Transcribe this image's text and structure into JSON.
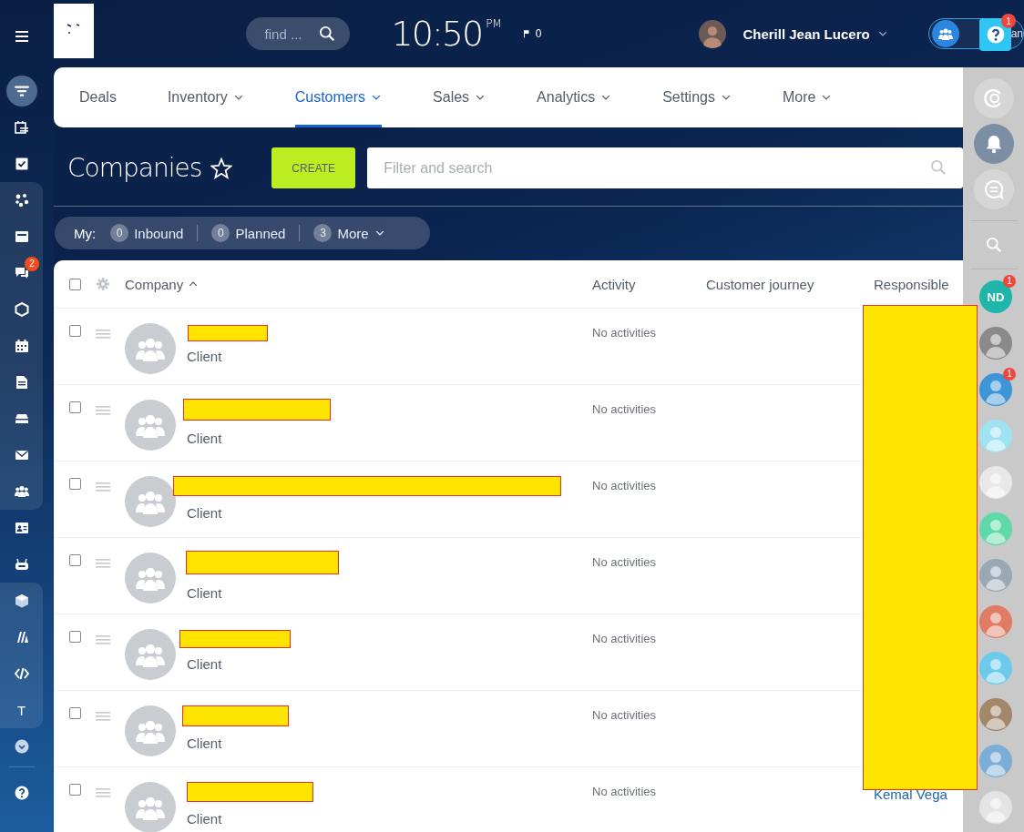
{
  "sidebar": {
    "chat_badge": "2",
    "text_tool": "T"
  },
  "header": {
    "search": {
      "placeholder": "find ..."
    },
    "time": "10:50",
    "meridiem": "PM",
    "flags": "0",
    "user": {
      "name": "Cherill Jean Lucero"
    },
    "workspace": {
      "label": "an"
    },
    "help": {
      "badge": "1"
    }
  },
  "tabs": [
    {
      "label": "Deals",
      "selected": false,
      "dropdown": false
    },
    {
      "label": "Inventory",
      "selected": false,
      "dropdown": true
    },
    {
      "label": "Customers",
      "selected": true,
      "dropdown": true
    },
    {
      "label": "Sales",
      "selected": false,
      "dropdown": true
    },
    {
      "label": "Analytics",
      "selected": false,
      "dropdown": true
    },
    {
      "label": "Settings",
      "selected": false,
      "dropdown": true
    },
    {
      "label": "More",
      "selected": false,
      "dropdown": true
    }
  ],
  "page": {
    "title": "Companies",
    "create": "CREATE",
    "filter": {
      "placeholder": "Filter and search"
    }
  },
  "counters": {
    "label": "My:",
    "items": [
      {
        "count": "0",
        "label": "Inbound",
        "dropdown": false
      },
      {
        "count": "0",
        "label": "Planned",
        "dropdown": false
      },
      {
        "count": "3",
        "label": "More",
        "dropdown": true
      }
    ]
  },
  "table": {
    "all_checked": false,
    "columns": [
      {
        "label": "Company",
        "sorted": true
      },
      {
        "label": "Activity",
        "sorted": false
      },
      {
        "label": "Customer journey",
        "sorted": false
      },
      {
        "label": "Responsible",
        "sorted": false
      }
    ],
    "rows": [
      {
        "checked": false,
        "type": "Client",
        "activity": "No activities"
      },
      {
        "checked": false,
        "type": "Client",
        "activity": "No activities"
      },
      {
        "checked": false,
        "type": "Client",
        "activity": "No activities"
      },
      {
        "checked": false,
        "type": "Client",
        "activity": "No activities"
      },
      {
        "checked": false,
        "type": "Client",
        "activity": "No activities"
      },
      {
        "checked": false,
        "type": "Client",
        "activity": "No activities"
      },
      {
        "checked": false,
        "type": "Client",
        "activity": "No activities",
        "responsible": "Kemal Vega"
      }
    ]
  },
  "contacts": [
    {
      "kind": "initials",
      "initials": "ND",
      "badge": "1",
      "color": "#1fb5a8"
    },
    {
      "kind": "photo",
      "color": "#8a8a8a"
    },
    {
      "kind": "photo",
      "badge": "1",
      "color": "#3b95d6"
    },
    {
      "kind": "photo",
      "color": "#9fe3f2"
    },
    {
      "kind": "photo",
      "color": "#e8e8e8"
    },
    {
      "kind": "photo",
      "color": "#5fd9a8"
    },
    {
      "kind": "photo",
      "color": "#9aa8b5"
    },
    {
      "kind": "photo",
      "color": "#e07b64"
    },
    {
      "kind": "photo",
      "color": "#6ccbeb"
    },
    {
      "kind": "photo",
      "color": "#a2876a"
    },
    {
      "kind": "photo",
      "color": "#7baed6"
    },
    {
      "kind": "photo",
      "color": "#e4e4e4"
    }
  ]
}
